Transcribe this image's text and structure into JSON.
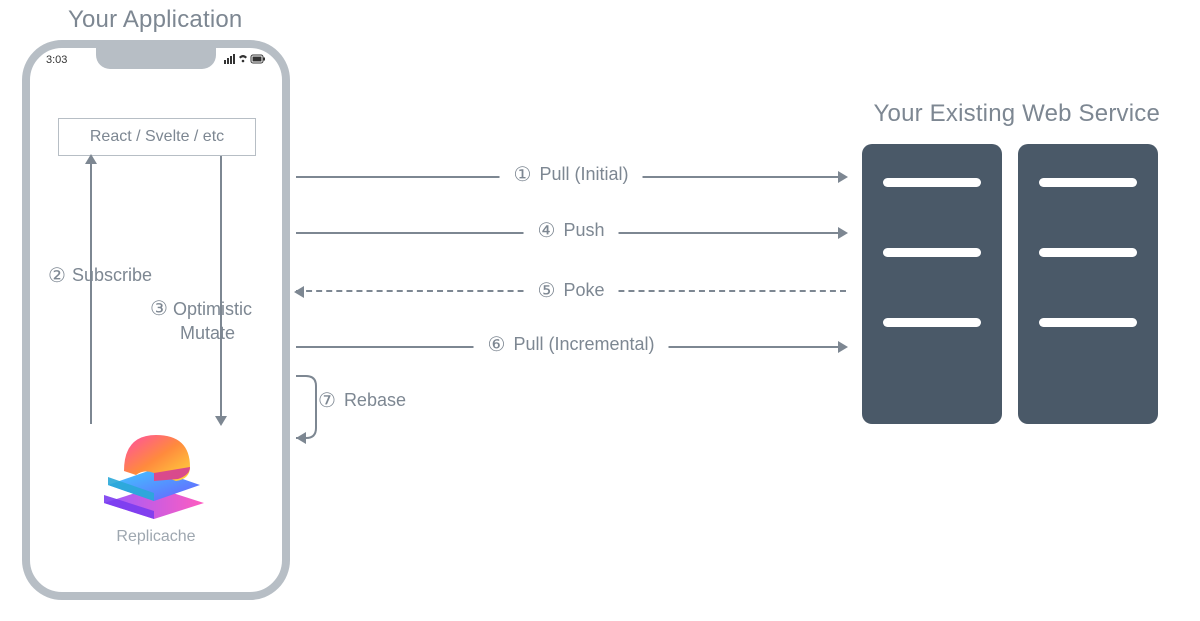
{
  "titles": {
    "app": "Your Application",
    "service": "Your Existing Web Service"
  },
  "phone": {
    "time": "3:03",
    "ui_layer": "React / Svelte / etc",
    "subscribe_num": "②",
    "subscribe": "Subscribe",
    "optimistic_num": "③",
    "optimistic_l1": "Optimistic",
    "optimistic_l2": "Mutate",
    "cache_name": "Replicache"
  },
  "arrows": {
    "pull_initial": {
      "num": "①",
      "text": "Pull (Initial)"
    },
    "push": {
      "num": "④",
      "text": "Push"
    },
    "poke": {
      "num": "⑤",
      "text": "Poke"
    },
    "pull_incremental": {
      "num": "⑥",
      "text": "Pull (Incremental)"
    },
    "rebase": {
      "num": "⑦",
      "text": "Rebase"
    }
  }
}
